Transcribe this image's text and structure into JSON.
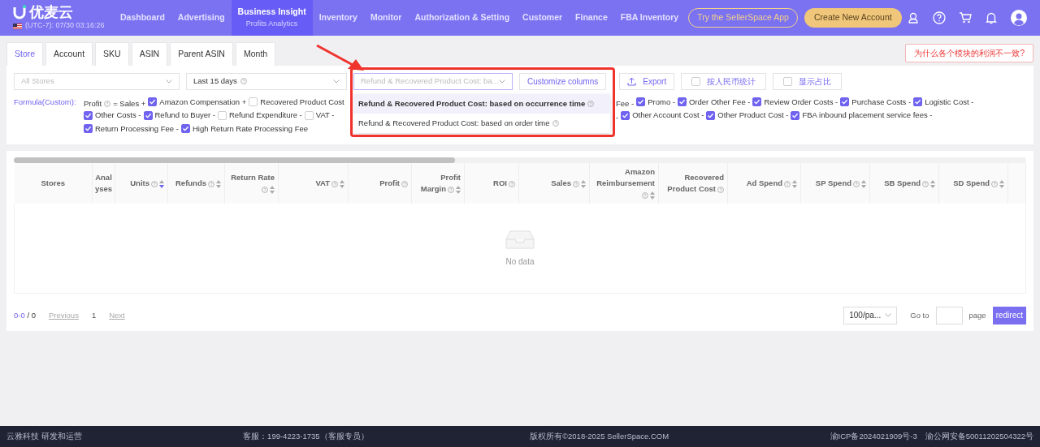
{
  "header": {
    "logo": "优麦云",
    "clock": "(UTC-7): 07/30 03:16:26",
    "nav": [
      {
        "label": "Dashboard",
        "selected": false
      },
      {
        "label": "Advertising",
        "selected": false
      },
      {
        "label": "Business Insight",
        "selected": true,
        "sub": "Profits Analytics"
      },
      {
        "label": "Inventory",
        "selected": false
      },
      {
        "label": "Monitor",
        "selected": false
      },
      {
        "label": "Authorization & Setting",
        "selected": false
      },
      {
        "label": "Customer",
        "selected": false
      },
      {
        "label": "Finance",
        "selected": false
      },
      {
        "label": "FBA Inventory",
        "selected": false
      }
    ],
    "app_button": "Try the SellerSpace App",
    "create_button": "Create New Account"
  },
  "tabs": [
    {
      "label": "Store",
      "selected": true
    },
    {
      "label": "Account",
      "selected": false
    },
    {
      "label": "SKU",
      "selected": false
    },
    {
      "label": "ASIN",
      "selected": false
    },
    {
      "label": "Parent ASIN",
      "selected": false
    },
    {
      "label": "Month",
      "selected": false
    }
  ],
  "why_button": "为什么各个模块的利润不一致?",
  "filters": {
    "store": {
      "placeholder": "All Stores"
    },
    "range": {
      "value": "Last 15 days"
    },
    "cost_basis": {
      "value": "Refund & Recovered Product Cost: ba...",
      "expanded": true,
      "options": [
        {
          "label": "Refund & Recovered Product Cost: based on occurrence time",
          "selected": true
        },
        {
          "label": "Refund & Recovered Product Cost: based on order time",
          "selected": false
        }
      ]
    },
    "customize": "Customize columns",
    "export": "Export",
    "toggles": [
      {
        "label": "按人民币统计",
        "checked": false
      },
      {
        "label": "显示占比",
        "checked": false
      }
    ]
  },
  "formula": {
    "label": "Formula(Custom):",
    "lines": [
      {
        "left": [
          {
            "kind": "text",
            "label": "Profit",
            "help": true
          },
          {
            "kind": "text",
            "label": "= Sales +"
          },
          {
            "kind": "checkbox",
            "label": "Amazon Compensation +",
            "checked": true
          },
          {
            "kind": "checkbox",
            "label": "Recovered Product Cost",
            "checked": false
          }
        ],
        "right": [
          {
            "kind": "text",
            "label": "Fee -"
          },
          {
            "kind": "checkbox",
            "label": "Promo -",
            "checked": true
          },
          {
            "kind": "checkbox",
            "label": "Order Other Fee -",
            "checked": true
          },
          {
            "kind": "checkbox",
            "label": "Review Order Costs -",
            "checked": true
          },
          {
            "kind": "checkbox",
            "label": "Purchase Costs -",
            "checked": true
          },
          {
            "kind": "checkbox",
            "label": "Logistic Cost -",
            "checked": true
          }
        ]
      },
      {
        "left": [
          {
            "kind": "checkbox",
            "label": "Other Costs -",
            "checked": true
          },
          {
            "kind": "checkbox",
            "label": "Refund to Buyer -",
            "checked": true
          },
          {
            "kind": "checkbox",
            "label": "Refund Expenditure -",
            "checked": false
          },
          {
            "kind": "checkbox",
            "label": "VAT -",
            "checked": false
          }
        ],
        "right": [
          {
            "kind": "text",
            "label": "-"
          },
          {
            "kind": "checkbox",
            "label": "Other Account Cost -",
            "checked": true
          },
          {
            "kind": "checkbox",
            "label": "Other Product Cost -",
            "checked": true
          },
          {
            "kind": "checkbox",
            "label": "FBA inbound placement service fees -",
            "checked": true
          }
        ]
      },
      {
        "left": [
          {
            "kind": "checkbox",
            "label": "Return Processing Fee -",
            "checked": true
          },
          {
            "kind": "checkbox",
            "label": "High Return Rate Processing Fee",
            "checked": true
          }
        ]
      }
    ]
  },
  "table": {
    "columns": [
      {
        "label": "Stores",
        "help": false,
        "sortable": false
      },
      {
        "label": "Analyses",
        "help": false,
        "sortable": false
      },
      {
        "label": "Units",
        "help": true,
        "sortable": true,
        "sorted": true
      },
      {
        "label": "Refunds",
        "help": true,
        "sortable": true,
        "sorted": false
      },
      {
        "label": "Return Rate",
        "help": true,
        "sortable": true,
        "sorted": false
      },
      {
        "label": "VAT",
        "help": true,
        "sortable": true,
        "sorted": false
      },
      {
        "label": "Profit",
        "help": true,
        "sortable": false
      },
      {
        "label": "Profit Margin",
        "help": true,
        "sortable": true,
        "sorted": false
      },
      {
        "label": "ROI",
        "help": true,
        "sortable": false
      },
      {
        "label": "Sales",
        "help": true,
        "sortable": true,
        "sorted": false
      },
      {
        "label": "Amazon Reimbursement",
        "help": true,
        "sortable": true,
        "sorted": false
      },
      {
        "label": "Recovered Product Cost",
        "help": true,
        "sortable": false
      },
      {
        "label": "Ad Spend",
        "help": true,
        "sortable": true,
        "sorted": false
      },
      {
        "label": "SP Spend",
        "help": true,
        "sortable": true,
        "sorted": false
      },
      {
        "label": "SB Spend",
        "help": true,
        "sortable": true,
        "sorted": false
      },
      {
        "label": "SD Spend",
        "help": true,
        "sortable": true,
        "sorted": false
      }
    ],
    "empty": "No data"
  },
  "pagination": {
    "range": "0-0",
    "total": "/ 0",
    "previous": "Previous",
    "page": "1",
    "next": "Next",
    "page_size": "100/pa...",
    "goto": "Go to",
    "page_label": "page",
    "redirect": "redirect"
  },
  "footer": [
    "云雅科技 研发和运营",
    "客服：199-4223-1735（客服专员）",
    "版权所有©2018-2025 SellerSpace.COM",
    "渝ICP备2024021909号-3　渝公网安备50011202504322号"
  ]
}
